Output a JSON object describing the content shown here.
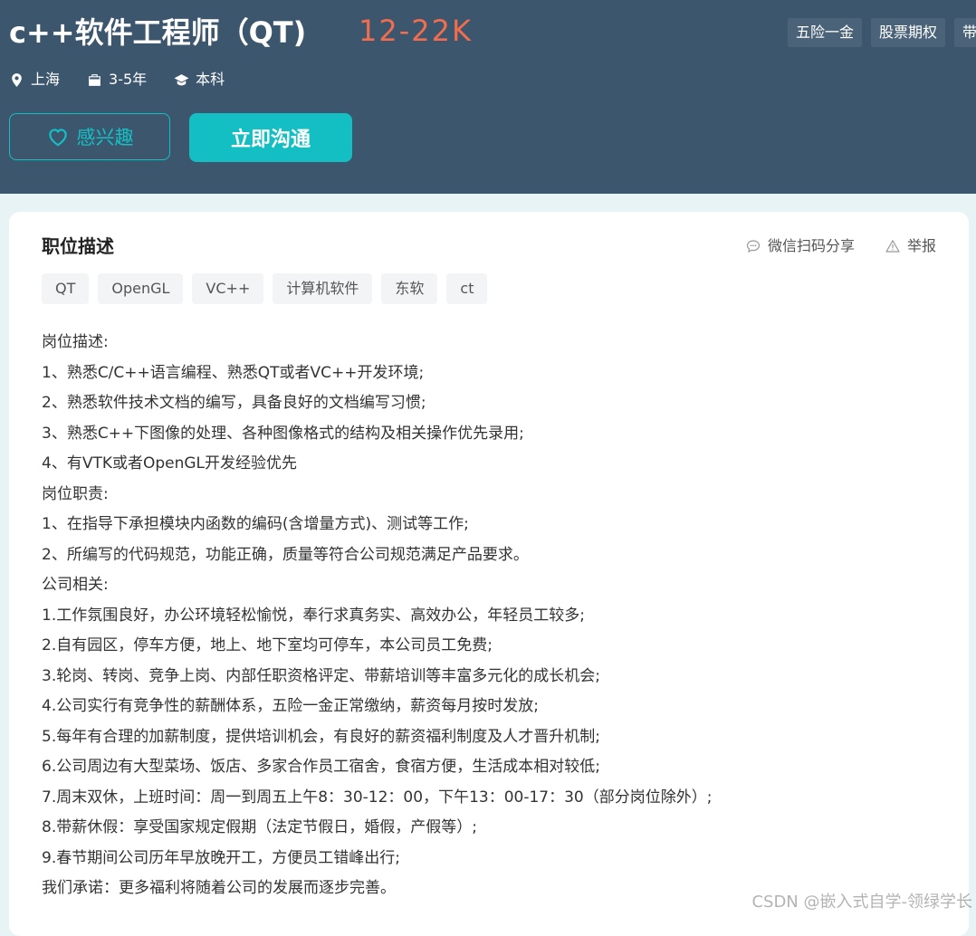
{
  "job": {
    "title": "c++软件工程师（QT)",
    "salary": "12-22K",
    "welfare": [
      "五险一金",
      "股票期权",
      "带"
    ],
    "location": "上海",
    "experience": "3-5年",
    "education": "本科"
  },
  "buttons": {
    "interest": "感兴趣",
    "chat": "立即沟通"
  },
  "section": {
    "title": "职位描述",
    "share": "微信扫码分享",
    "report": "举报",
    "tags": [
      "QT",
      "OpenGL",
      "VC++",
      "计算机软件",
      "东软",
      "ct"
    ]
  },
  "description": [
    "岗位描述:",
    "1、熟悉C/C++语言编程、熟悉QT或者VC++开发环境;",
    "2、熟悉软件技术文档的编写，具备良好的文档编写习惯;",
    "3、熟悉C++下图像的处理、各种图像格式的结构及相关操作优先录用;",
    "4、有VTK或者OpenGL开发经验优先",
    "岗位职责:",
    "1、在指导下承担模块内函数的编码(含增量方式)、测试等工作;",
    "2、所编写的代码规范，功能正确，质量等符合公司规范满足产品要求。",
    "公司相关:",
    "1.工作氛围良好，办公环境轻松愉悦，奉行求真务实、高效办公，年轻员工较多;",
    "2.自有园区，停车方便，地上、地下室均可停车，本公司员工免费;",
    "3.轮岗、转岗、竞争上岗、内部任职资格评定、带薪培训等丰富多元化的成长机会;",
    "4.公司实行有竞争性的薪酬体系，五险一金正常缴纳，薪资每月按时发放;",
    "5.每年有合理的加薪制度，提供培训机会，有良好的薪资福利制度及人才晋升机制;",
    "6.公司周边有大型菜场、饭店、多家合作员工宿舍，食宿方便，生活成本相对较低;",
    "7.周末双休，上班时间：周一到周五上午8：30-12：00，下午13：00-17：30（部分岗位除外）;",
    "8.带薪休假：享受国家规定假期（法定节假日，婚假，产假等）;",
    "9.春节期间公司历年早放晚开工，方便员工错峰出行;",
    "我们承诺：更多福利将随着公司的发展而逐步完善。"
  ],
  "watermark": "CSDN @嵌入式自学-领绿学长",
  "colors": {
    "header_bg": "#3c566e",
    "salary": "#f26d4d",
    "accent": "#13bfc3"
  }
}
